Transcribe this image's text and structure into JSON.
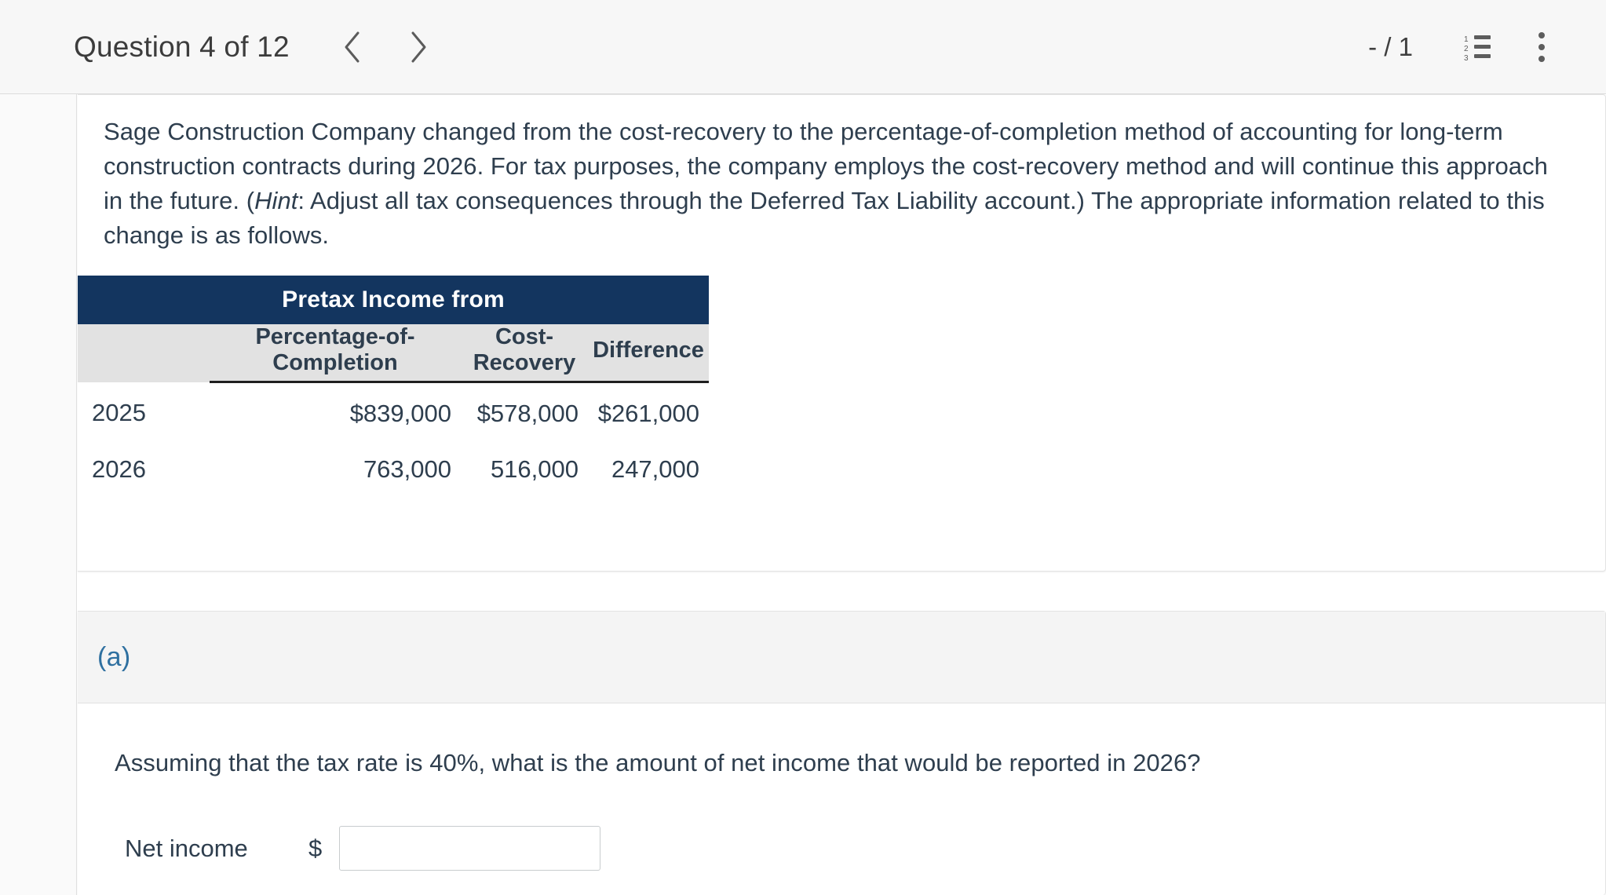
{
  "toolbar": {
    "question_title": "Question 4 of 12",
    "prev_label": "Previous question",
    "next_label": "Next question",
    "page_indicator": "- / 1",
    "list_icon_name": "numbered-list-icon",
    "list_numbers": [
      "1",
      "2",
      "3"
    ],
    "more_label": "More options"
  },
  "question": {
    "paragraph_part1": "Sage Construction Company changed from the cost-recovery to the percentage-of-completion method of accounting for long-term construction contracts during 2026. For tax purposes, the company employs the cost-recovery method and will continue this approach in the future. (",
    "hint_word": "Hint",
    "paragraph_part2": ": Adjust all tax consequences through the Deferred Tax Liability account.) The appropriate information related to this change is as follows."
  },
  "table": {
    "banner": "Pretax Income from",
    "columns": [
      "",
      "Percentage-of-Completion",
      "Cost-Recovery",
      "Difference"
    ],
    "rows": [
      {
        "year": "2025",
        "poc": "$839,000",
        "cost_recovery": "$578,000",
        "difference": "$261,000"
      },
      {
        "year": "2026",
        "poc": "763,000",
        "cost_recovery": "516,000",
        "difference": "247,000"
      }
    ]
  },
  "part_a": {
    "letter": "(a)",
    "question": "Assuming that the tax rate is 40%, what is the amount of net income that would be reported in 2026?",
    "answer_label": "Net income",
    "currency_symbol": "$",
    "answer_value": "",
    "answer_placeholder": ""
  },
  "colors": {
    "banner_navy": "#13355f",
    "subhead_gray": "#e2e2e2",
    "text_dark": "#2e3e4e",
    "part_letter_blue": "#2f70a0",
    "toolbar_bg": "#f7f7f7"
  }
}
